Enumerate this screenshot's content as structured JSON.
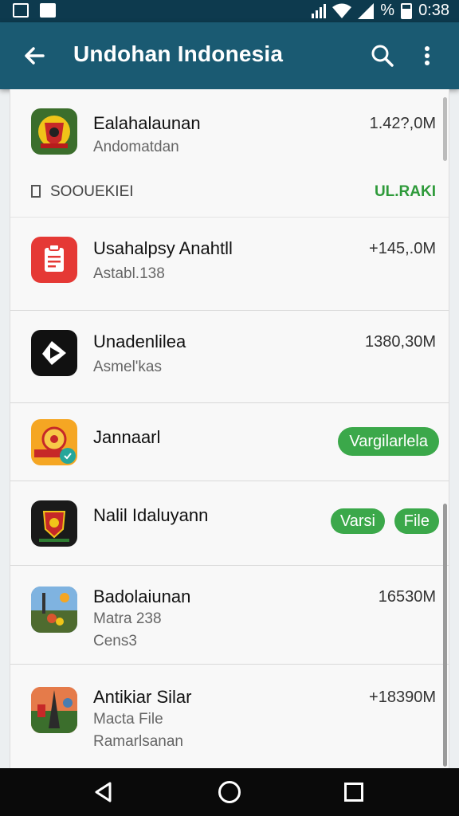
{
  "status_bar": {
    "battery": "%",
    "time": "0:38"
  },
  "app_bar": {
    "title": "Undohan Indonesia",
    "back_icon": "arrow-left-icon",
    "search_icon": "search-icon",
    "menu_icon": "more-vert-icon"
  },
  "section": {
    "label": "SOOUEKIEI",
    "action": "UL.RAKI"
  },
  "items": [
    {
      "title": "Ealahalaunan",
      "subtitle": "Andomatdan",
      "size": "1.42?,0M",
      "icon": "emblem-icon",
      "icon_bg": "#3b6e2c"
    },
    {
      "title": "Usahalpsy Anahtll",
      "subtitle": "Astabl.138",
      "size": "+145,.0M",
      "icon": "clipboard-icon",
      "icon_bg": "#e53935"
    },
    {
      "title": "Unadenlilea",
      "subtitle": "Asmel'kas",
      "size": "1380,30M",
      "icon": "play-icon",
      "icon_bg": "#111111"
    },
    {
      "title": "Jannaarl",
      "button": "Vargilarlela",
      "icon": "sun-emblem-icon",
      "icon_bg": "#f5a623"
    },
    {
      "title": "Nalil Idaluyann",
      "button1": "Varsi",
      "button2": "File",
      "icon": "shield-icon",
      "icon_bg": "#1a1a1a"
    },
    {
      "title": "Badolaiunan",
      "subtitle": "Matra 238",
      "subtitle2": "Cens3",
      "size": "16530M",
      "icon": "landscape-icon",
      "icon_bg": "#4a7db0"
    },
    {
      "title": "Antikiar Silar",
      "subtitle": "Macta File",
      "subtitle2": "Ramarlsanan",
      "size": "+18390M",
      "icon": "tower-icon",
      "icon_bg": "#d9552e"
    }
  ],
  "nav": {
    "back_icon": "nav-back-icon",
    "home_icon": "nav-home-icon",
    "recent_icon": "nav-recent-icon"
  }
}
